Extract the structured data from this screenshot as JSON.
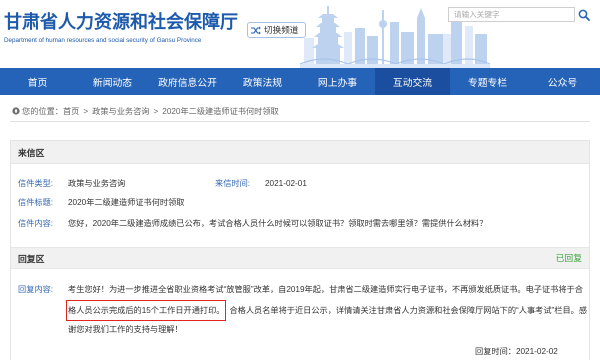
{
  "header": {
    "site_title": "甘肃省人力资源和社会保障厅",
    "site_subtitle": "Department of human resources and social security of Gansu Province",
    "switch_channel": {
      "label": "切换频道",
      "icon": "shuffle-icon"
    },
    "search": {
      "placeholder": "请输入关键字",
      "value": "",
      "icon": "search-icon"
    }
  },
  "nav": {
    "items": [
      {
        "label": "首页",
        "active": false
      },
      {
        "label": "新闻动态",
        "active": false
      },
      {
        "label": "政府信息公开",
        "active": false
      },
      {
        "label": "政策法规",
        "active": false
      },
      {
        "label": "网上办事",
        "active": false
      },
      {
        "label": "互动交流",
        "active": true
      },
      {
        "label": "专题专栏",
        "active": false
      },
      {
        "label": "公众号",
        "active": false
      }
    ]
  },
  "breadcrumb": {
    "icon": "location-icon",
    "prefix": "您的位置：",
    "separator": ">",
    "items": [
      "首页",
      "政策与业务咨询",
      "2020年二级建造师证书何时领取"
    ]
  },
  "letter": {
    "section_title": "来信区",
    "type": {
      "label": "信件类型:",
      "value": "政策与业务咨询"
    },
    "time": {
      "label": "来信时间:",
      "value": "2021-02-01"
    },
    "title": {
      "label": "信件标题:",
      "value": "2020年二级建造师证书何时领取"
    },
    "content": {
      "label": "信件内容:",
      "value": "您好，2020年二级建造师成绩已公布，考试合格人员什么时候可以领取证书？领取时需去哪里领？需提供什么材料？"
    }
  },
  "reply": {
    "section_title": "回复区",
    "status": "已回复",
    "content": {
      "label": "回复内容:",
      "line_1": "考生您好！为进一步推进全省职业资格考试“放管服”改革，自2019年起，甘肃省二级建造师实行电子证书，不再颁发纸质证书。电子证书将于合",
      "line_2_highlighted": "格人员公示完成后的15个工作日开通打印。",
      "line_2_rest": "合格人员名单将于近日公示，详情请关注甘肃省人力资源和社会保障厅网站下的“人事考试”栏目。感",
      "line_3": "谢您对我们工作的支持与理解！"
    },
    "time": {
      "label": "回复时间：",
      "value": "2021-02-02"
    }
  },
  "colors": {
    "brand_blue": "#1d5aab",
    "nav_blue": "#2563b8",
    "nav_active": "#1b4e9e",
    "label_blue": "#3468b3",
    "section_bg": "#f1f1f1",
    "status_green": "#3aa53a",
    "highlight_red": "#e0261e",
    "skyline_blue": "#bcd2ef"
  }
}
